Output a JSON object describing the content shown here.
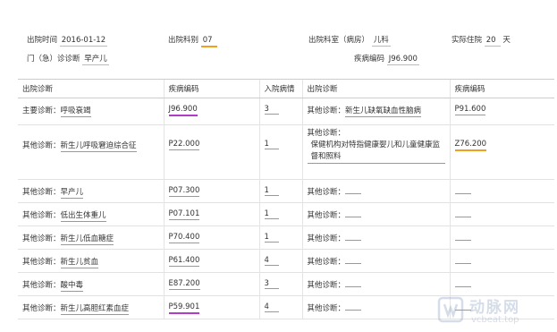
{
  "header": {
    "discharge_time_label": "出院时间",
    "discharge_time_value": "2016-01-12",
    "discharge_dept_label": "出院科别",
    "discharge_dept_value": "07",
    "discharge_room_label": "出院科室（病房）",
    "discharge_room_value": "儿科",
    "actual_stay_label": "实际住院",
    "actual_stay_value": "20",
    "actual_stay_unit": "天",
    "outpatient_dx_label": "门（急）诊诊断",
    "outpatient_dx_value": "早产儿",
    "disease_code_label": "疾病编码",
    "disease_code_value": "J96.900"
  },
  "table": {
    "headers": [
      "出院诊断",
      "疾病编码",
      "入院病情",
      "出院诊断",
      "疾病编码"
    ],
    "rows": [
      {
        "prefix": "主要诊断：",
        "dx": "呼吸衰竭",
        "code": "J96.900",
        "cond": "3",
        "odx_prefix": "其他诊断：",
        "odx": "新生儿缺氧缺血性脑病",
        "ocode": "P91.600"
      },
      {
        "prefix": "其他诊断：",
        "dx": "新生儿呼吸窘迫综合征",
        "code": "P22.000",
        "cond": "1",
        "odx_prefix": "其他诊断：",
        "odx": "保健机构对特指健康婴儿和儿童健康监督和照料",
        "ocode": "Z76.200"
      },
      {
        "prefix": "其他诊断：",
        "dx": "早产儿",
        "code": "P07.300",
        "cond": "1",
        "odx_prefix": "其他诊断：",
        "odx": "",
        "ocode": ""
      },
      {
        "prefix": "其他诊断：",
        "dx": "低出生体重儿",
        "code": "P07.101",
        "cond": "1",
        "odx_prefix": "其他诊断：",
        "odx": "",
        "ocode": ""
      },
      {
        "prefix": "其他诊断：",
        "dx": "新生儿低血糖症",
        "code": "P70.400",
        "cond": "1",
        "odx_prefix": "其他诊断：",
        "odx": "",
        "ocode": ""
      },
      {
        "prefix": "其他诊断：",
        "dx": "新生儿贫血",
        "code": "P61.400",
        "cond": "4",
        "odx_prefix": "其他诊断：",
        "odx": "",
        "ocode": ""
      },
      {
        "prefix": "其他诊断：",
        "dx": "酸中毒",
        "code": "E87.200",
        "cond": "3",
        "odx_prefix": "其他诊断：",
        "odx": "",
        "ocode": ""
      },
      {
        "prefix": "其他诊断：",
        "dx": "新生儿高胆红素血症",
        "code": "P59.901",
        "cond": "4",
        "odx_prefix": "其他诊断：",
        "odx": "",
        "ocode": ""
      }
    ]
  },
  "watermark": {
    "brand": "动脉网",
    "url": "vcbeat.top"
  },
  "colors": {
    "highlight_orange": "#f0a020",
    "highlight_purple": "#b03cc8"
  }
}
